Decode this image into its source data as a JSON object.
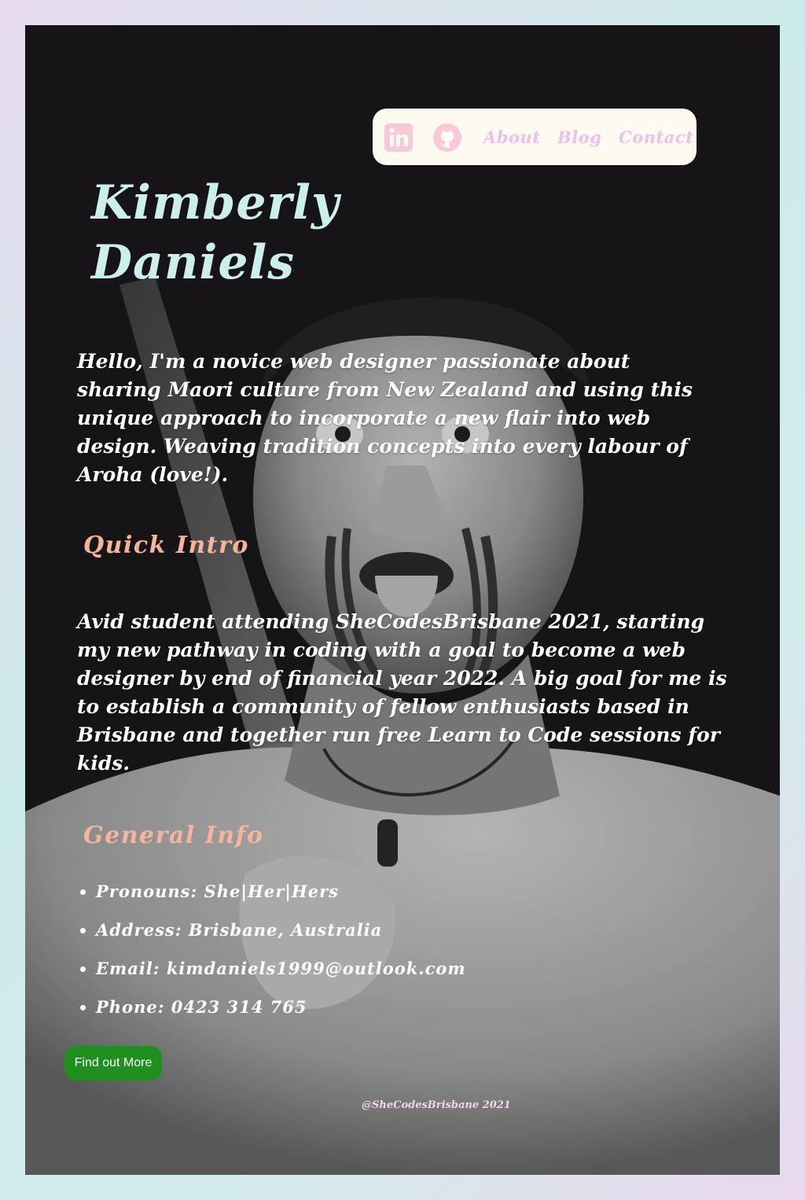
{
  "nav": {
    "linkedin_icon": "linkedin-icon",
    "github_icon": "github-icon",
    "about": "About",
    "blog": "Blog",
    "contact": "Contact"
  },
  "hero": {
    "name_line1": "Kimberly",
    "name_line2": "Daniels",
    "intro": "Hello, I'm a novice web designer passionate about sharing Maori culture from New Zealand and using this unique approach to incorporate a new flair into web design. Weaving tradition concepts into every labour of Aroha (love!)."
  },
  "quick_intro": {
    "heading": "Quick Intro",
    "body": "Avid student attending SheCodesBrisbane 2021, starting my new pathway in coding with a goal to become a web designer by end of financial year 2022. A big goal for me is to establish a community of fellow enthusiasts based in Brisbane and together run free Learn to Code sessions for kids."
  },
  "general_info": {
    "heading": "General Info",
    "items": [
      "Pronouns: She|Her|Hers",
      "Address: Brisbane, Australia",
      "Email: kimdaniels1999@outlook.com",
      "Phone: 0423 314 765"
    ]
  },
  "cta": {
    "label": "Find out More"
  },
  "footer": {
    "text": "@SheCodesBrisbane 2021"
  },
  "colors": {
    "card_bg": "#1b191d",
    "nav_bg": "#fdfbef",
    "nav_link": "#edbfee",
    "name": "#cdefeb",
    "heading": "#f6b59a",
    "button": "#1f8f1f",
    "icon_pink": "#f7c9d9"
  }
}
